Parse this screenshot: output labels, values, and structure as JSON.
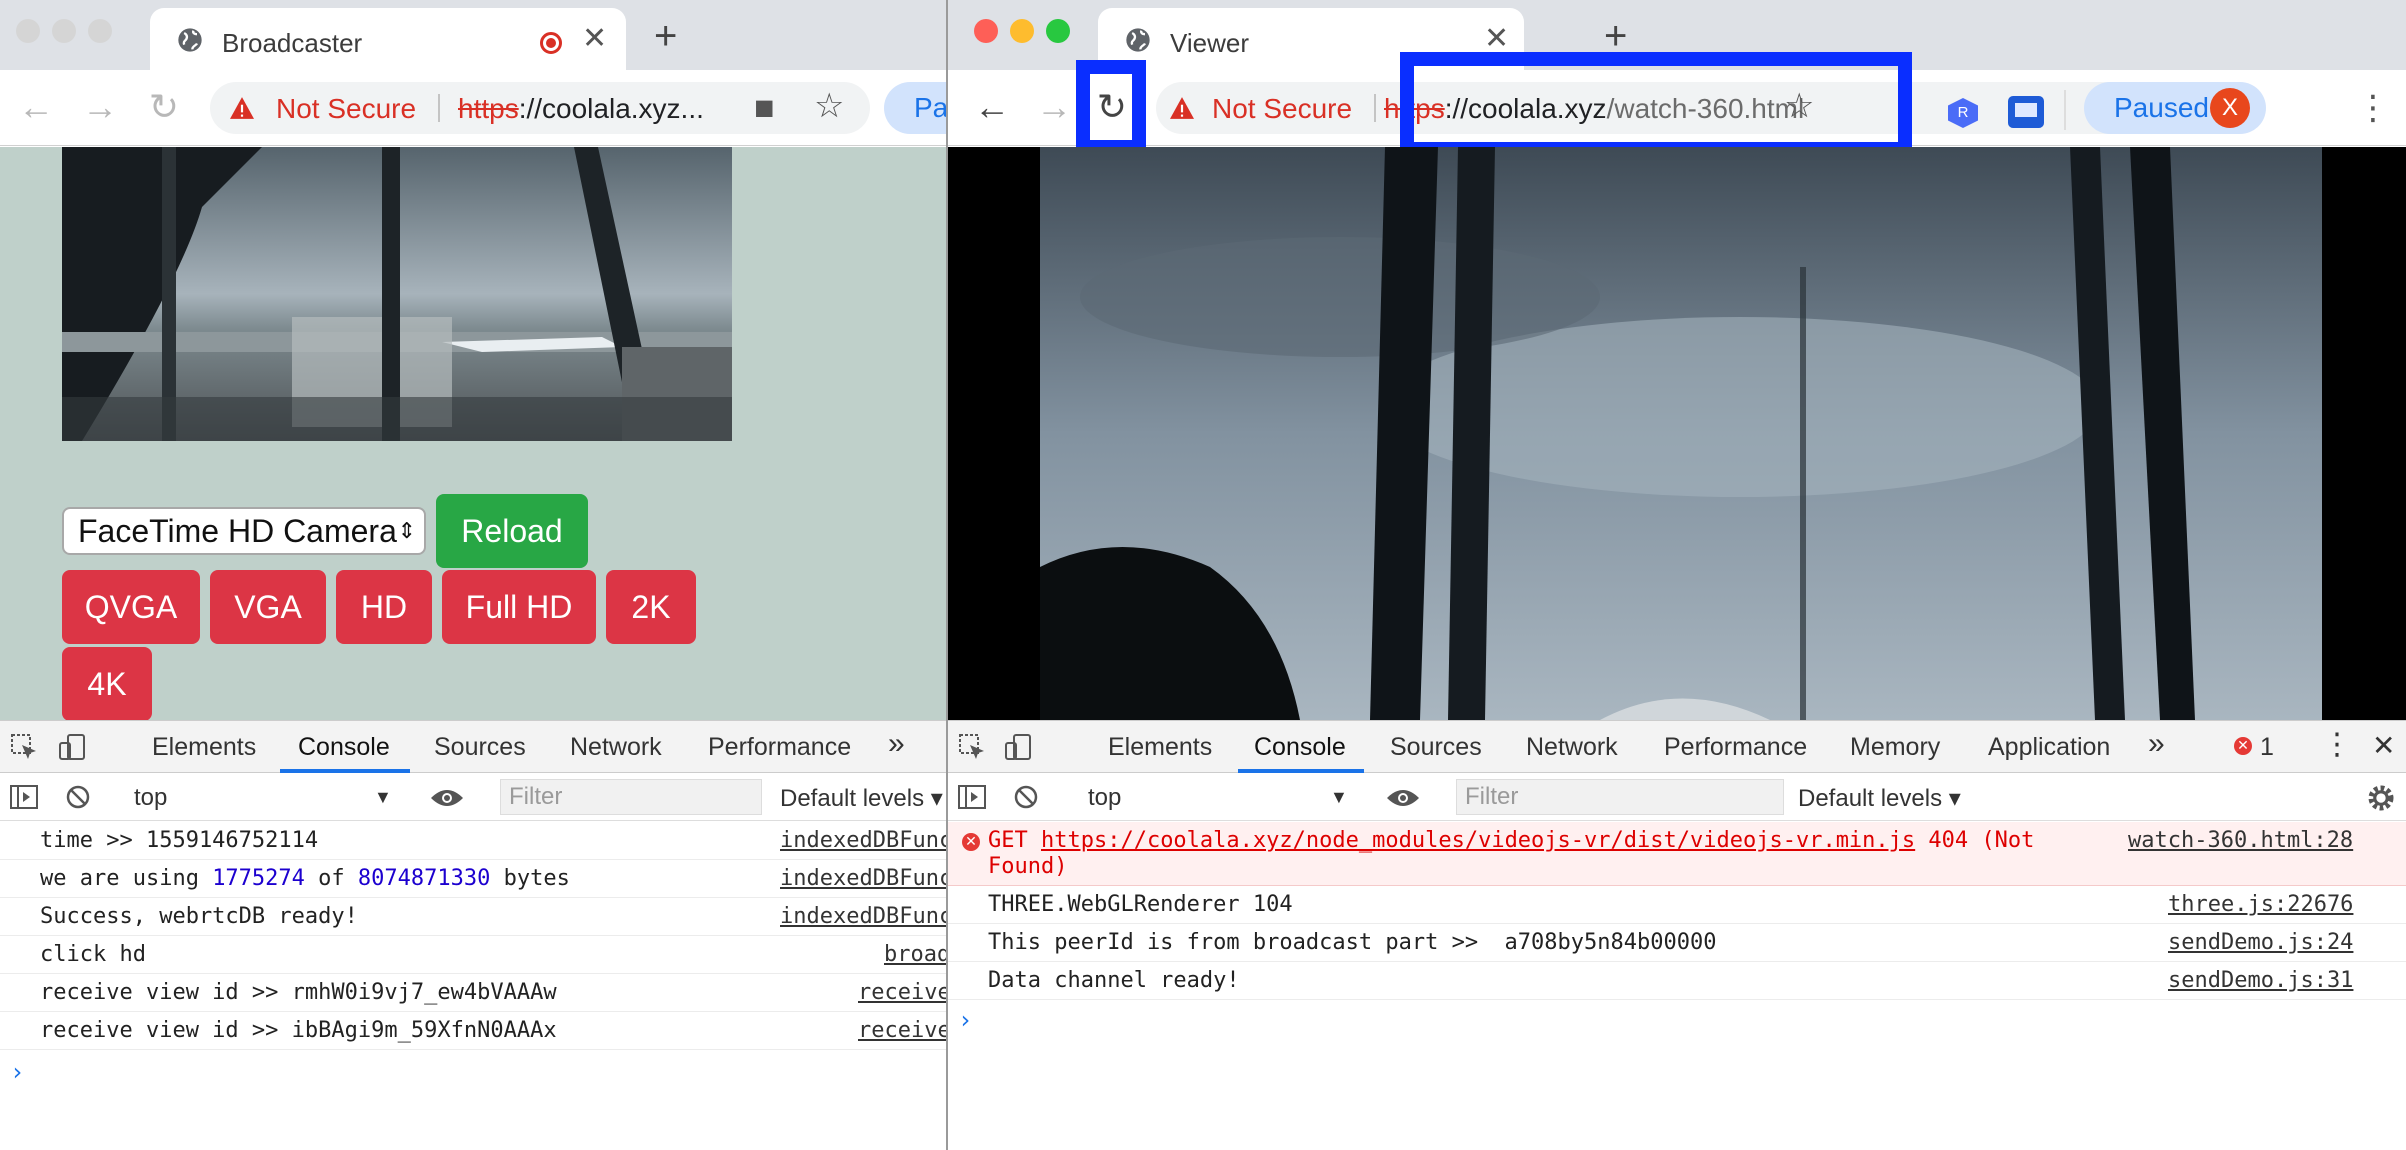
{
  "left": {
    "tab_title": "Broadcaster",
    "new_tab": "+",
    "tab_close": "✕",
    "security_label": "Not Secure",
    "url_scheme": "https",
    "url_rest": "://coolala.xyz...",
    "profile_paused_partial": "Paus",
    "camera_select": "FaceTime HD Camera",
    "reload_button": "Reload",
    "resolution_buttons": [
      "QVGA",
      "VGA",
      "HD",
      "Full HD",
      "2K",
      "4K"
    ],
    "devtools": {
      "tabs": [
        "Elements",
        "Console",
        "Sources",
        "Network",
        "Performance"
      ],
      "more": "»",
      "context": "top",
      "filter_placeholder": "Filter",
      "levels": "Default levels ▾",
      "console_rows": [
        {
          "text": "time >> 1559146752114",
          "src": "indexedDBFunc"
        },
        {
          "pre": "we are using ",
          "n1": "1775274",
          "mid": " of ",
          "n2": "8074871330",
          "post": " bytes",
          "src": "indexedDBFunc"
        },
        {
          "text": "Success, webrtcDB ready!",
          "src": "indexedDBFunc"
        },
        {
          "text": "click hd",
          "src": "broadc"
        },
        {
          "text": "receive view id >> rmhW0i9vj7_ew4bVAAAw",
          "src": "receive"
        },
        {
          "text": "receive view id >> ibBAgi9m_59XfnN0AAAx",
          "src": "receive"
        }
      ],
      "prompt": "›"
    }
  },
  "right": {
    "tab_title": "Viewer",
    "new_tab": "+",
    "tab_close": "✕",
    "security_label": "Not Secure",
    "url_scheme": "https",
    "url_host": "://coolala.xyz",
    "url_path": "/watch-360.html",
    "profile_paused": "Paused",
    "avatar_letter": "X",
    "devtools": {
      "tabs": [
        "Elements",
        "Console",
        "Sources",
        "Network",
        "Performance",
        "Memory",
        "Application"
      ],
      "more": "»",
      "error_count": "1",
      "context": "top",
      "filter_placeholder": "Filter",
      "levels": "Default levels ▾",
      "error_row": {
        "method": "GET ",
        "link": "https://coolala.xyz/node_modules/videojs-vr/dist/videojs-vr.min.js",
        "status": " 404 (Not",
        "status2": "Found)",
        "src": "watch-360.html:28"
      },
      "console_rows": [
        {
          "text": "THREE.WebGLRenderer 104",
          "src": "three.js:22676"
        },
        {
          "text": "This peerId is from broadcast part >>  a708by5n84b00000",
          "src": "sendDemo.js:24"
        },
        {
          "text": "Data channel ready!",
          "src": "sendDemo.js:31"
        }
      ],
      "prompt": "›"
    }
  },
  "colors": {
    "highlight": "#0a2eff",
    "danger": "#dc3545",
    "success": "#28a745",
    "page_bg": "#bfd0ca"
  }
}
